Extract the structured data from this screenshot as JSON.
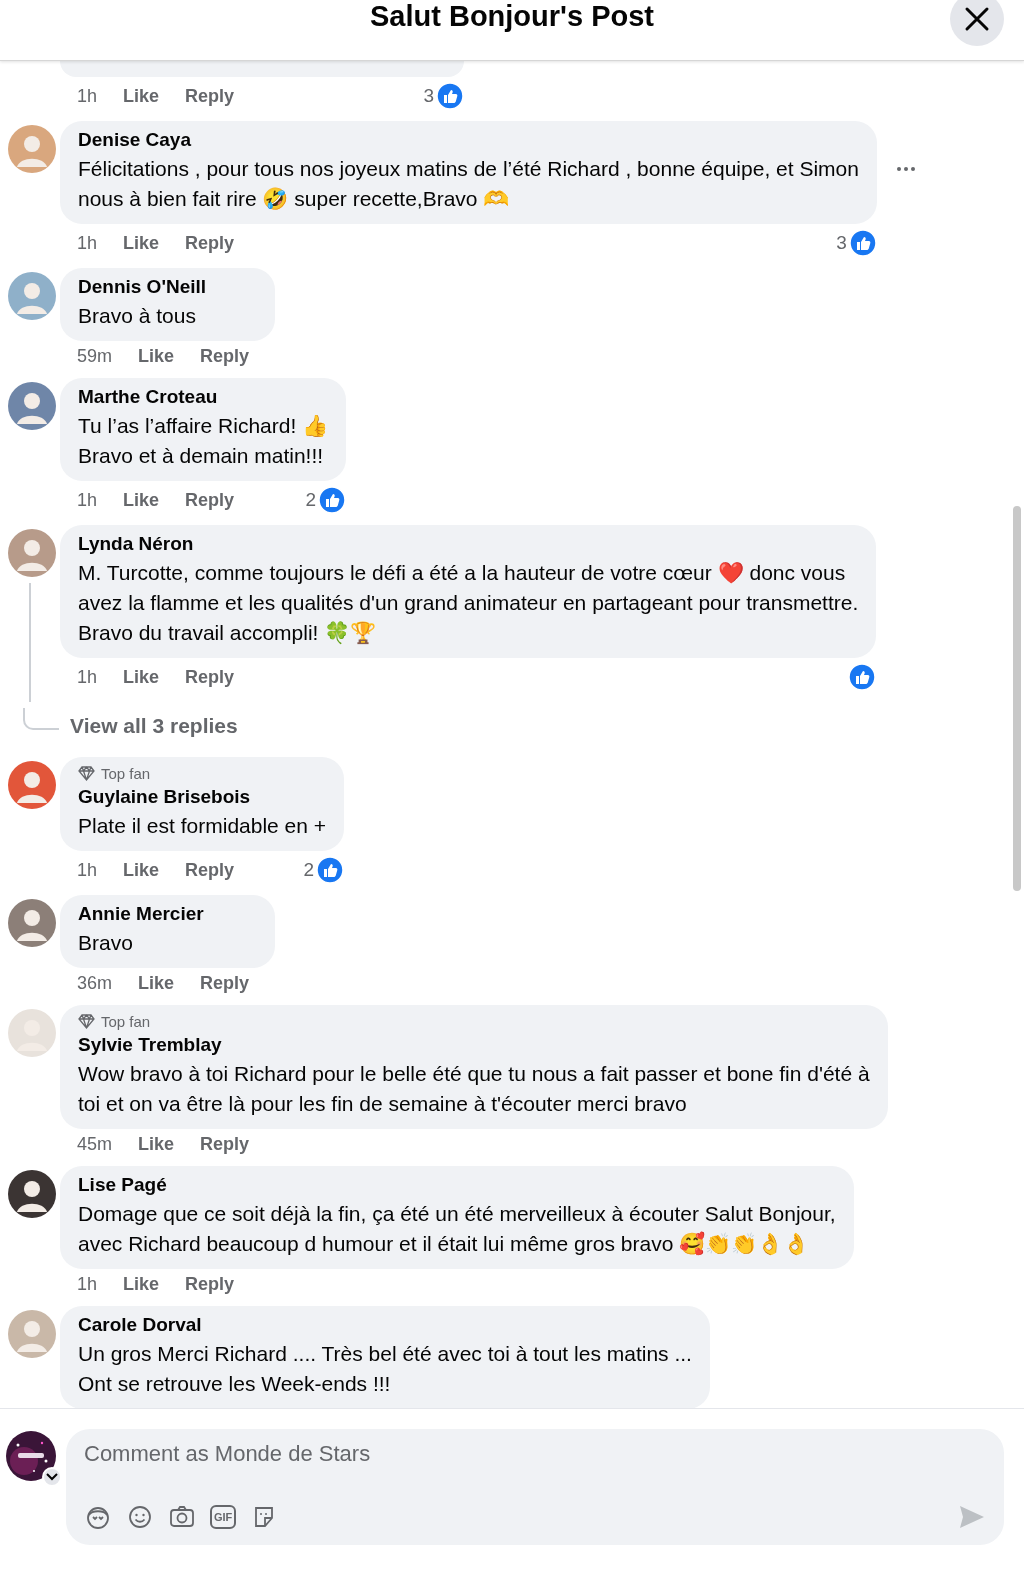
{
  "header": {
    "title": "Salut Bonjour's Post"
  },
  "comments": [
    {
      "kind": "partial",
      "time": "1h",
      "like": "Like",
      "reply": "Reply",
      "reaction": true,
      "reaction_count": "3"
    },
    {
      "kind": "comment",
      "name": "Denise Caya",
      "top_fan": false,
      "text": "Félicitations , pour tous nos joyeux matins de l’été Richard , bonne équipe, et Simon\nnous à bien fait rire 🤣 super recette,Bravo 🫶",
      "time": "1h",
      "like": "Like",
      "reply": "Reply",
      "reaction": true,
      "reaction_count": "3",
      "more_menu": true
    },
    {
      "kind": "comment",
      "name": "Dennis O'Neill",
      "top_fan": false,
      "text": "Bravo à tous",
      "time": "59m",
      "like": "Like",
      "reply": "Reply",
      "reaction": false
    },
    {
      "kind": "comment",
      "name": "Marthe Croteau",
      "top_fan": false,
      "text": "Tu l’as l’affaire Richard! 👍\nBravo et à demain matin!!!",
      "time": "1h",
      "like": "Like",
      "reply": "Reply",
      "reaction": true,
      "reaction_count": "2"
    },
    {
      "kind": "comment",
      "name": "Lynda Néron",
      "top_fan": false,
      "text": "M. Turcotte, comme toujours le défi a été a la hauteur de votre cœur ❤️ donc vous\navez la flamme et les qualités d'un grand animateur en partageant pour transmettre.\nBravo du travail accompli! 🍀🏆",
      "time": "1h",
      "like": "Like",
      "reply": "Reply",
      "reaction": true,
      "replies_link": "View all 3 replies"
    },
    {
      "kind": "comment",
      "name": "Guylaine Brisebois",
      "top_fan": true,
      "badge": "Top fan",
      "text": "Plate il est formidable en +",
      "time": "1h",
      "like": "Like",
      "reply": "Reply",
      "reaction": true,
      "reaction_count": "2"
    },
    {
      "kind": "comment",
      "name": "Annie Mercier",
      "top_fan": false,
      "text": "Bravo",
      "time": "36m",
      "like": "Like",
      "reply": "Reply",
      "reaction": false
    },
    {
      "kind": "comment",
      "name": "Sylvie Tremblay",
      "top_fan": true,
      "badge": "Top fan",
      "text": "Wow bravo à toi Richard pour le belle été que tu nous a fait passer et bone fin d'été à\ntoi et on va être là pour les fin de semaine à t'écouter merci bravo",
      "time": "45m",
      "like": "Like",
      "reply": "Reply",
      "reaction": false
    },
    {
      "kind": "comment",
      "name": "Lise Pagé",
      "top_fan": false,
      "text": "Domage que ce soit déjà la fin, ça été un été merveilleux à écouter Salut Bonjour,\navec Richard beaucoup d humour et il était lui même gros bravo 🥰👏👏👌👌",
      "time": "1h",
      "like": "Like",
      "reply": "Reply",
      "reaction": false
    },
    {
      "kind": "comment",
      "name": "Carole Dorval",
      "top_fan": false,
      "text": "Un gros Merci Richard .... Très bel été avec toi à tout les matins ...\nOnt se retrouve les Week-ends !!!"
    }
  ],
  "composer": {
    "placeholder": "Comment as Monde de Stars",
    "gif_label": "GIF"
  }
}
